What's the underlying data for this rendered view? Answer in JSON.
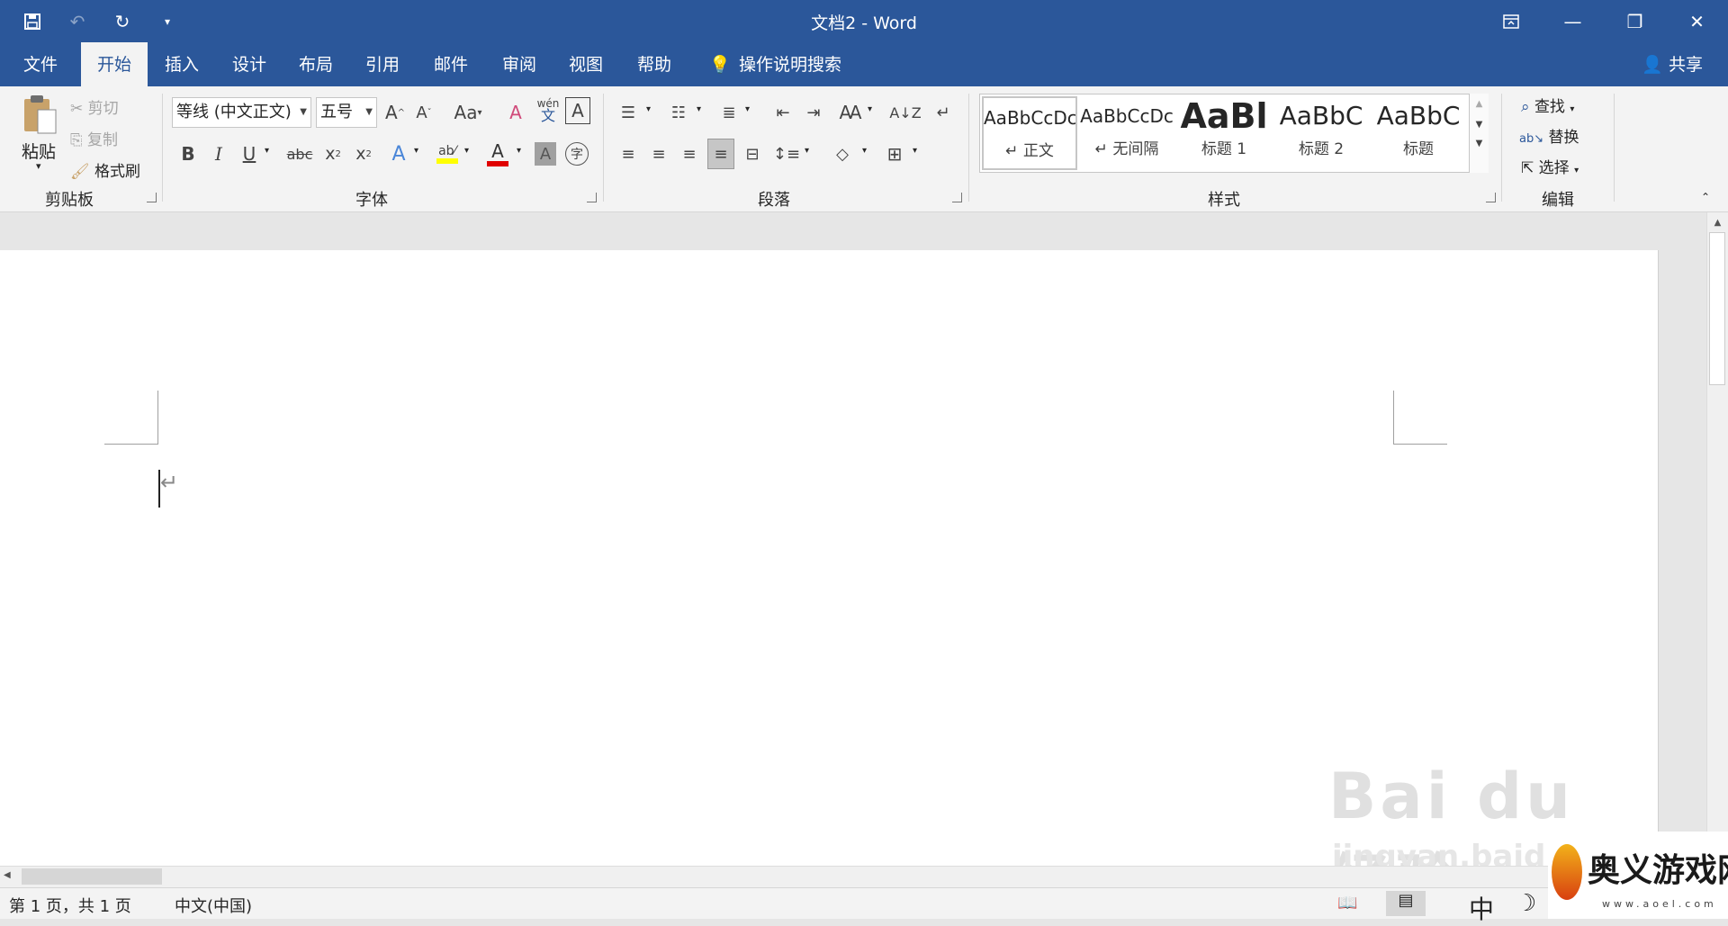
{
  "window": {
    "title": "文档2  -  Word"
  },
  "menu": {
    "tabs": [
      "文件",
      "开始",
      "插入",
      "设计",
      "布局",
      "引用",
      "邮件",
      "审阅",
      "视图",
      "帮助"
    ],
    "tell_me": "操作说明搜索",
    "share": "共享"
  },
  "clipboard": {
    "paste": "粘贴",
    "cut": "剪切",
    "copy": "复制",
    "format_painter": "格式刷",
    "label": "剪贴板"
  },
  "font": {
    "name": "等线 (中文正文)",
    "size": "五号",
    "label": "字体",
    "case": "Aa",
    "phonetic": "wén",
    "phonetic_char": "文",
    "border_char": "A",
    "bold": "B",
    "italic": "I",
    "underline": "U",
    "strike": "abc",
    "sub": "x",
    "sup": "x",
    "highlight_color": "#ffff00",
    "font_color": "#e00000"
  },
  "paragraph": {
    "label": "段落"
  },
  "styles": {
    "label": "样式",
    "items": [
      {
        "preview": "AaBbCcDc",
        "name": "↵ 正文"
      },
      {
        "preview": "AaBbCcDc",
        "name": "↵ 无间隔"
      },
      {
        "preview": "AaBl",
        "name": "标题 1"
      },
      {
        "preview": "AaBbC",
        "name": "标题 2"
      },
      {
        "preview": "AaBbC",
        "name": "标题"
      }
    ]
  },
  "editing": {
    "find": "查找",
    "replace": "替换",
    "select": "选择",
    "label": "编辑"
  },
  "document": {
    "cursor_mark": "↵"
  },
  "status": {
    "page": "第 1 页，共 1 页",
    "language": "中文(中国)",
    "ime": "中"
  },
  "watermarks": {
    "baidu": "Bai du 经验",
    "baidu_url": "jingyan.baidu.com",
    "site": "奥义游戏网",
    "site_url": "www.aoel.com"
  }
}
